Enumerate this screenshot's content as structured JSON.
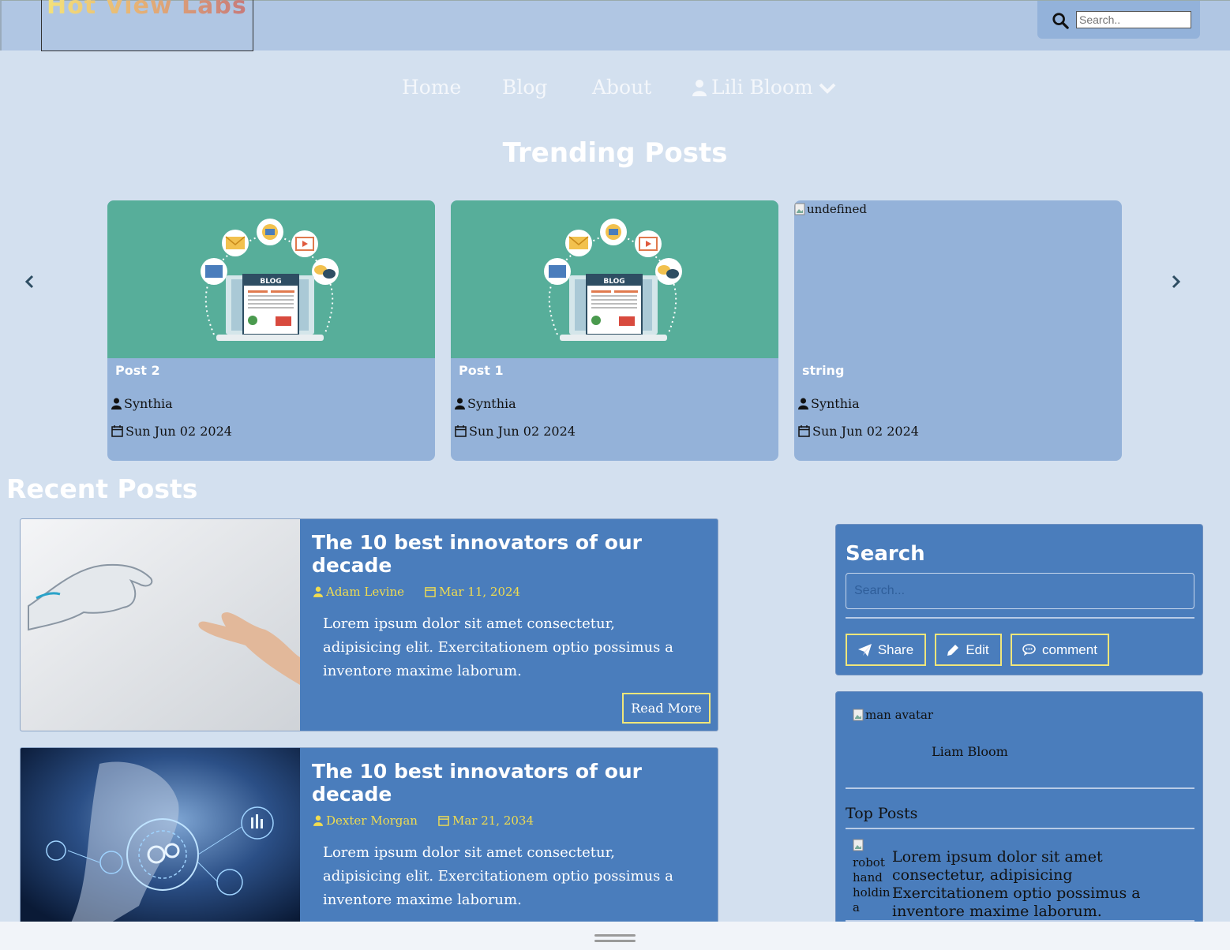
{
  "header": {
    "logo_text": "Hot View Labs",
    "search_placeholder": "Search.."
  },
  "nav": {
    "home": "Home",
    "blog": "Blog",
    "about": "About",
    "user": "Lili Bloom"
  },
  "trending": {
    "title": "Trending Posts",
    "cards": [
      {
        "title": "Post 2",
        "author": "Synthia",
        "date": "Sun Jun 02 2024",
        "image": "blog-illustration"
      },
      {
        "title": "Post 1",
        "author": "Synthia",
        "date": "Sun Jun 02 2024",
        "image": "blog-illustration"
      },
      {
        "title": "string",
        "author": "Synthia",
        "date": "Sun Jun 02 2024",
        "image_alt": "undefined"
      }
    ]
  },
  "recent": {
    "title": "Recent Posts",
    "posts": [
      {
        "title": "The 10 best innovators of our decade",
        "author": "Adam Levine",
        "date": "Mar 11, 2024",
        "body": "Lorem ipsum dolor sit amet consectetur, adipisicing elit. Exercitationem optio possimus a inventore maxime laborum.",
        "read_more": "Read More",
        "image": "robot-hand-photo"
      },
      {
        "title": "The 10 best innovators of our decade",
        "author": "Dexter Morgan",
        "date": "Mar 21, 2034",
        "body": "Lorem ipsum dolor sit amet consectetur, adipisicing elit. Exercitationem optio possimus a inventore maxime laborum.",
        "image": "tech-gears-photo"
      }
    ]
  },
  "sidebar": {
    "search_title": "Search",
    "search_placeholder": "Search...",
    "share_label": "Share",
    "edit_label": "Edit",
    "comment_label": "comment",
    "avatar_alt": "man avatar",
    "profile_name": "Liam Bloom",
    "top_posts_label": "Top Posts",
    "top_post_img_alt": "robot hand holdin a",
    "top_post_text": "Lorem ipsum dolor sit amet consectetur, adipisicing Exercitationem optio possimus a inventore maxime laborum."
  },
  "colors": {
    "topbar": "#b0c6e3",
    "page_bg": "#d3e0ef",
    "card_bg": "#94b2d9",
    "post_bg": "#4a7dbc",
    "accent_yellow": "#f0dc50"
  }
}
